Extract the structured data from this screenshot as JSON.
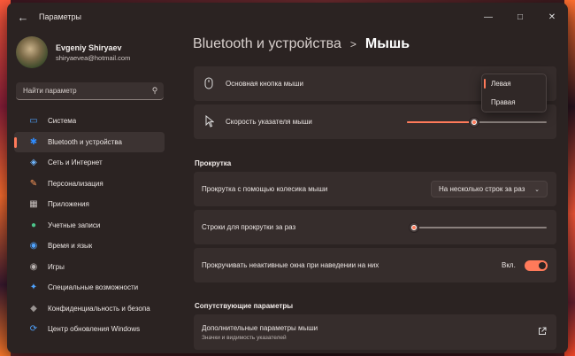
{
  "window": {
    "title": "Параметры",
    "back_icon": "arrow-left-icon",
    "controls": [
      "minimize-icon",
      "maximize-icon",
      "close-icon"
    ]
  },
  "profile": {
    "name": "Evgeniy Shiryaev",
    "email": "shiryaevea@hotmail.com"
  },
  "search": {
    "placeholder": "Найти параметр"
  },
  "sidebar": {
    "items": [
      {
        "label": "Система",
        "icon": "monitor-icon",
        "color": "#4fa3ff",
        "active": false
      },
      {
        "label": "Bluetooth и устройства",
        "icon": "bluetooth-icon",
        "color": "#2f8cff",
        "active": true
      },
      {
        "label": "Сеть и Интернет",
        "icon": "wifi-icon",
        "color": "#6fb7ff",
        "active": false
      },
      {
        "label": "Персонализация",
        "icon": "brush-icon",
        "color": "#ff9a5a",
        "active": false
      },
      {
        "label": "Приложения",
        "icon": "apps-icon",
        "color": "#c9c2c0",
        "active": false
      },
      {
        "label": "Учетные записи",
        "icon": "person-icon",
        "color": "#4cc48a",
        "active": false
      },
      {
        "label": "Время и язык",
        "icon": "globe-clock-icon",
        "color": "#4fa3ff",
        "active": false
      },
      {
        "label": "Игры",
        "icon": "gamepad-icon",
        "color": "#b9b2b0",
        "active": false
      },
      {
        "label": "Специальные возможности",
        "icon": "accessibility-icon",
        "color": "#4fa3ff",
        "active": false
      },
      {
        "label": "Конфиденциальность и безопа",
        "icon": "shield-icon",
        "color": "#9a9492",
        "active": false
      },
      {
        "label": "Центр обновления Windows",
        "icon": "update-icon",
        "color": "#4fa3ff",
        "active": false
      }
    ]
  },
  "breadcrumb": {
    "parent": "Bluetooth и устройства",
    "separator": ">",
    "current": "Мышь"
  },
  "settings": {
    "primary_button": {
      "label": "Основная кнопка мыши",
      "options": [
        "Левая",
        "Правая"
      ],
      "selected": "Левая"
    },
    "pointer_speed": {
      "label": "Скорость указателя мыши",
      "value_fraction": 0.48
    },
    "scroll_section": "Прокрутка",
    "wheel_scroll": {
      "label": "Прокрутка с помощью колесика мыши",
      "value": "На несколько строк за раз"
    },
    "lines_to_scroll": {
      "label": "Строки для прокрутки за раз",
      "value_fraction": 0.03
    },
    "inactive_scroll": {
      "label": "Прокручивать неактивные окна при наведении на них",
      "state_label": "Вкл.",
      "on": true
    },
    "related_section": "Сопутствующие параметры",
    "more_mouse": {
      "title": "Дополнительные параметры мыши",
      "subtitle": "Значки и видимость указателей",
      "icon": "external-link-icon"
    }
  },
  "colors": {
    "accent": "#ff7a5a",
    "window_bg": "#2b2322",
    "card_bg": "#362d2c"
  }
}
